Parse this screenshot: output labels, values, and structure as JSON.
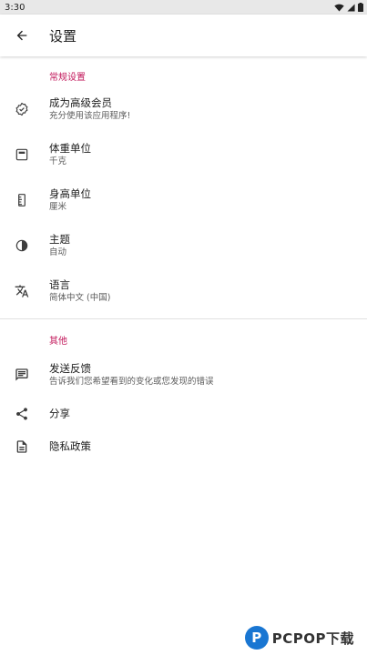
{
  "status_bar": {
    "time": "3:30"
  },
  "app_bar": {
    "title": "设置"
  },
  "sections": {
    "general": {
      "header": "常规设置",
      "premium": {
        "title": "成为高级会员",
        "subtitle": "充分使用该应用程序!"
      },
      "weight": {
        "title": "体重单位",
        "subtitle": "千克"
      },
      "height": {
        "title": "身高单位",
        "subtitle": "厘米"
      },
      "theme": {
        "title": "主题",
        "subtitle": "自动"
      },
      "language": {
        "title": "语言",
        "subtitle": "简体中文 (中国)"
      }
    },
    "other": {
      "header": "其他",
      "feedback": {
        "title": "发送反馈",
        "subtitle": "告诉我们您希望看到的变化或您发现的错误"
      },
      "share": {
        "title": "分享"
      },
      "privacy": {
        "title": "隐私政策"
      }
    }
  },
  "watermark": {
    "logo_letter": "P",
    "text": "PCPOP下载"
  },
  "colors": {
    "accent": "#c2185b",
    "icon": "#3d3d3d",
    "logo": "#1976d2"
  }
}
